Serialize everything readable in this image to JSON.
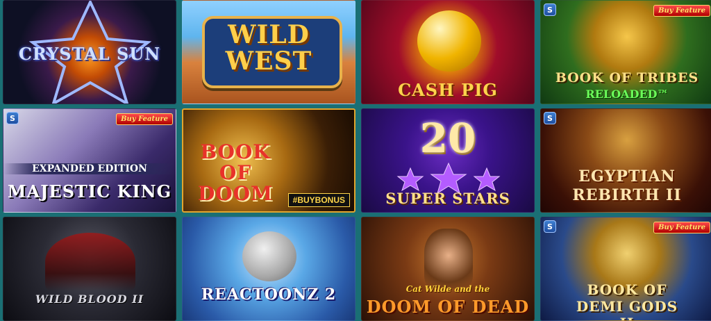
{
  "games": [
    {
      "title": "CRYSTAL SUN"
    },
    {
      "title": "WILD WEST"
    },
    {
      "title": "CASH PIG"
    },
    {
      "title": "BOOK OF TRIBES",
      "subtitle": "RELOADED™",
      "badge_s": "S",
      "buy_feature": "Buy Feature"
    },
    {
      "title": "MAJESTIC KING",
      "subtitle": "EXPANDED EDITION",
      "badge_s": "S",
      "buy_feature": "Buy Feature"
    },
    {
      "title": "BOOK OF DOOM",
      "tag": "#BUYBONUS"
    },
    {
      "number": "20",
      "title": "SUPER STARS"
    },
    {
      "title": "EGYPTIAN REBIRTH II",
      "badge_s": "S"
    },
    {
      "title": "WILD BLOOD II"
    },
    {
      "title": "REACTOONZ 2"
    },
    {
      "title": "DOOM OF DEAD",
      "subtitle": "Cat Wilde and the"
    },
    {
      "title": "BOOK OF DEMI GODS II",
      "badge_s": "S",
      "buy_feature": "Buy Feature"
    }
  ]
}
